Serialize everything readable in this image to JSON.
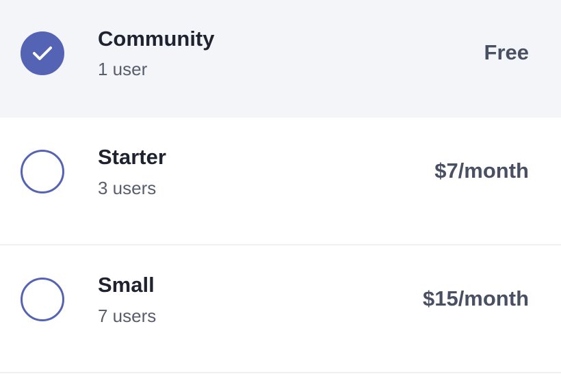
{
  "accent_color": "#5563b4",
  "plans": [
    {
      "name": "Community",
      "users": "1 user",
      "price": "Free",
      "selected": true,
      "icon": "check-icon"
    },
    {
      "name": "Starter",
      "users": "3 users",
      "price": "$7/month",
      "selected": false
    },
    {
      "name": "Small",
      "users": "7 users",
      "price": "$15/month",
      "selected": false
    }
  ]
}
